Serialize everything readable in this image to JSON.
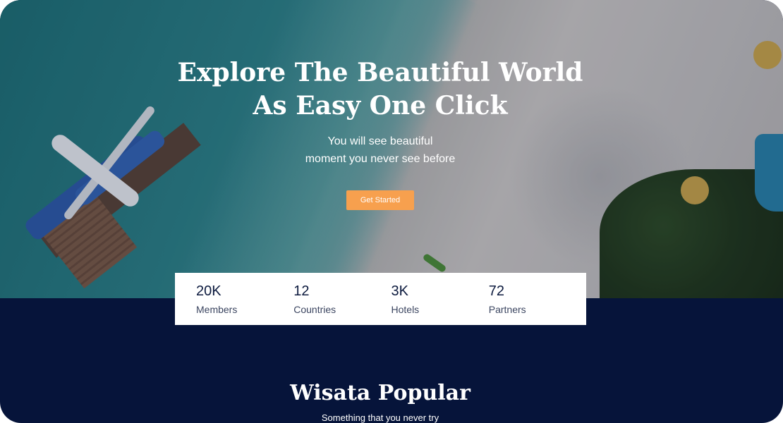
{
  "hero": {
    "title_line1": "Explore The Beautiful World",
    "title_line2": "As Easy One Click",
    "subtitle_line1": "You will see beautiful",
    "subtitle_line2": "moment you never see before",
    "cta_label": "Get Started"
  },
  "stats": [
    {
      "value": "20K",
      "label": "Members"
    },
    {
      "value": "12",
      "label": "Countries"
    },
    {
      "value": "3K",
      "label": "Hotels"
    },
    {
      "value": "72",
      "label": "Partners"
    }
  ],
  "popular": {
    "title": "Wisata Popular",
    "subtitle": "Something that you never try"
  },
  "colors": {
    "navy": "#06143a",
    "accent": "#f7a04e",
    "stat_text": "#0c1a3e"
  }
}
